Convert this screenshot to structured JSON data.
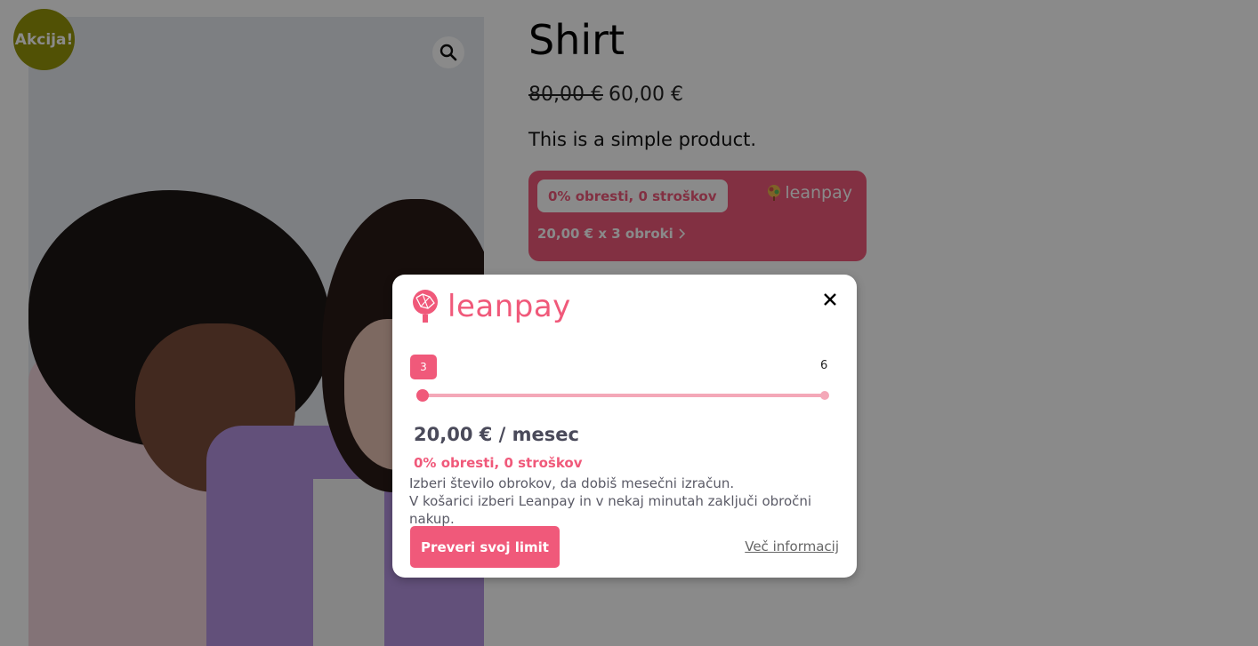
{
  "product": {
    "sale_badge": "Akcija!",
    "title": "Shirt",
    "price_old": "80,00 €",
    "price_new": "60,00 €",
    "short_description": "This is a simple product."
  },
  "leanpay_widget": {
    "pill_text": "0% obresti, 0 stroškov",
    "logo_text": "leanpay",
    "installments_text": "20,00 € x 3 obroki"
  },
  "modal": {
    "logo_text": "leanpay",
    "slider_min": "3",
    "slider_max": "6",
    "monthly_amount": "20,00 € / mesec",
    "no_interest": "0% obresti, 0 stroškov",
    "info_line1": "Izberi število obrokov, da dobiš mesečni izračun.",
    "info_line2": "V košarici izberi Leanpay in v nekaj minutah zaključi obročni nakup.",
    "check_limit_button": "Preveri svoj limit",
    "more_info_link": "Več informacij"
  },
  "colors": {
    "brand_pink": "#f0597a",
    "sale_badge": "#96960a"
  },
  "icons": {
    "zoom": "magnifier-icon",
    "close": "close-icon",
    "logo": "leanpay-logo-icon",
    "chevron": "chevron-right-icon"
  }
}
